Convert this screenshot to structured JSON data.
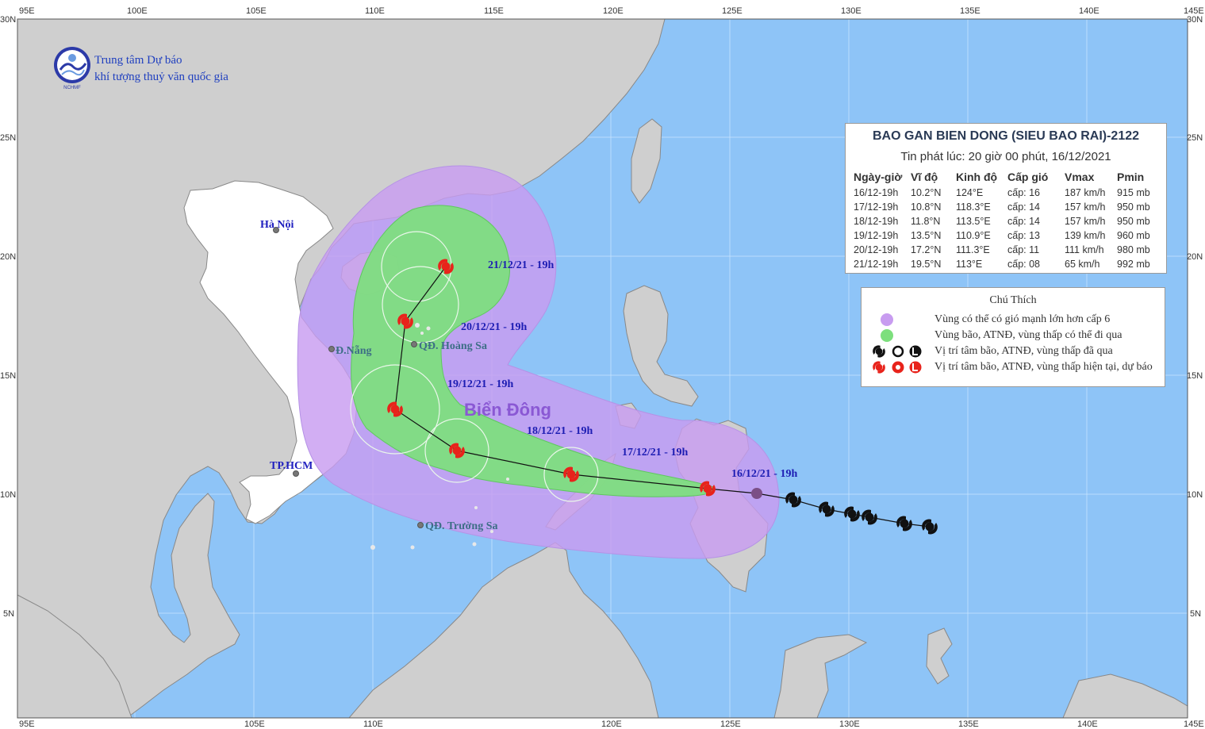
{
  "organization": {
    "line1": "Trung tâm Dự báo",
    "line2": "khí tượng thuỷ văn quốc gia",
    "logo_text": "NCHMF"
  },
  "axes": {
    "lon_top": [
      "95E",
      "100E",
      "105E",
      "110E",
      "115E",
      "120E",
      "125E",
      "130E",
      "135E",
      "140E",
      "145E"
    ],
    "lon_bottom": [
      "95E",
      "105E",
      "110E",
      "120E",
      "125E",
      "130E",
      "135E",
      "140E",
      "145E"
    ],
    "lat_left": [
      "30N",
      "25N",
      "20N",
      "15N",
      "10N",
      "5N"
    ],
    "lat_right": [
      "30N",
      "25N",
      "20N",
      "15N",
      "10N",
      "5N"
    ]
  },
  "places": {
    "hanoi": "Hà Nội",
    "danang": "Đ.Nẵng",
    "hoangsa": "QĐ. Hoàng Sa",
    "hcm": "TP.HCM",
    "truongsa": "QĐ. Trường Sa",
    "sea": "Biển Đông"
  },
  "forecast_labels": {
    "d16": "16/12/21 - 19h",
    "d17": "17/12/21 - 19h",
    "d18": "18/12/21 - 19h",
    "d19": "19/12/21 - 19h",
    "d20": "20/12/21 - 19h",
    "d21": "21/12/21 - 19h"
  },
  "bulletin": {
    "title": "BAO GAN BIEN DONG (SIEU BAO RAI)-2122",
    "issued": "Tin phát lúc: 20 giờ 00 phút, 16/12/2021",
    "columns": [
      "Ngày-giờ",
      "Vĩ độ",
      "Kinh độ",
      "Cấp gió",
      "Vmax",
      "Pmin"
    ],
    "rows": [
      [
        "16/12-19h",
        "10.2°N",
        "124°E",
        "cấp: 16",
        "187 km/h",
        "915 mb"
      ],
      [
        "17/12-19h",
        "10.8°N",
        "118.3°E",
        "cấp: 14",
        "157 km/h",
        "950 mb"
      ],
      [
        "18/12-19h",
        "11.8°N",
        "113.5°E",
        "cấp: 14",
        "157 km/h",
        "950 mb"
      ],
      [
        "19/12-19h",
        "13.5°N",
        "110.9°E",
        "cấp: 13",
        "139 km/h",
        "960 mb"
      ],
      [
        "20/12-19h",
        "17.2°N",
        "111.3°E",
        "cấp: 11",
        "111 km/h",
        "980 mb"
      ],
      [
        "21/12-19h",
        "19.5°N",
        "113°E",
        "cấp: 08",
        "65 km/h",
        "992 mb"
      ]
    ]
  },
  "legend": {
    "title": "Chú Thích",
    "items": [
      "Vùng có thể có gió mạnh lớn hơn cấp 6",
      "Vùng bão, ATNĐ, vùng thấp có thể đi qua",
      "Vị trí tâm bão, ATNĐ, vùng thấp đã qua",
      "Vị trí tâm bão, ATNĐ, vùng thấp hiện tại, dự báo"
    ]
  },
  "colors": {
    "ocean": "#8ec4f7",
    "land": "#cfcfcf",
    "vietnam": "#ffffff",
    "strong_wind_zone": "#c89cf0",
    "storm_zone": "#7ddf7d",
    "current_storm": "#e8231b",
    "past_storm": "#111111"
  }
}
